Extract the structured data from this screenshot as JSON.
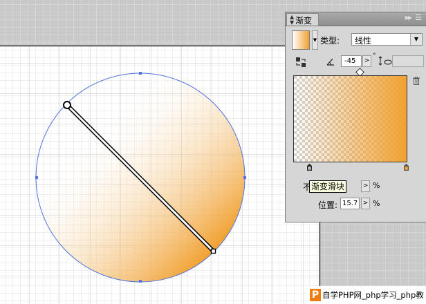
{
  "panel": {
    "tab_label": "渐变",
    "type_label": "类型:",
    "type_value": "线性",
    "angle_value": "-45",
    "angle_unit": "°",
    "opacity_label_fragment": "不",
    "tooltip": "渐变滑块",
    "opacity_unit": "%",
    "location_label": "位置:",
    "location_value": "15.7",
    "location_unit": "%"
  },
  "gradient": {
    "start_color": "#ffffff",
    "end_color": "#f1a131",
    "start_opacity": 0,
    "end_opacity": 1
  },
  "colors": {
    "selection_blue": "#3a63d8",
    "orange": "#f1a131",
    "canvas_gray": "#c9c9c9"
  },
  "watermark": {
    "logo": "P",
    "text": "自学PHP网_php学习_php教"
  },
  "icons": [
    "reverse-gradient-icon",
    "angle-icon",
    "aspect-ratio-icon",
    "delete-stop-icon",
    "panel-menu-icon"
  ]
}
